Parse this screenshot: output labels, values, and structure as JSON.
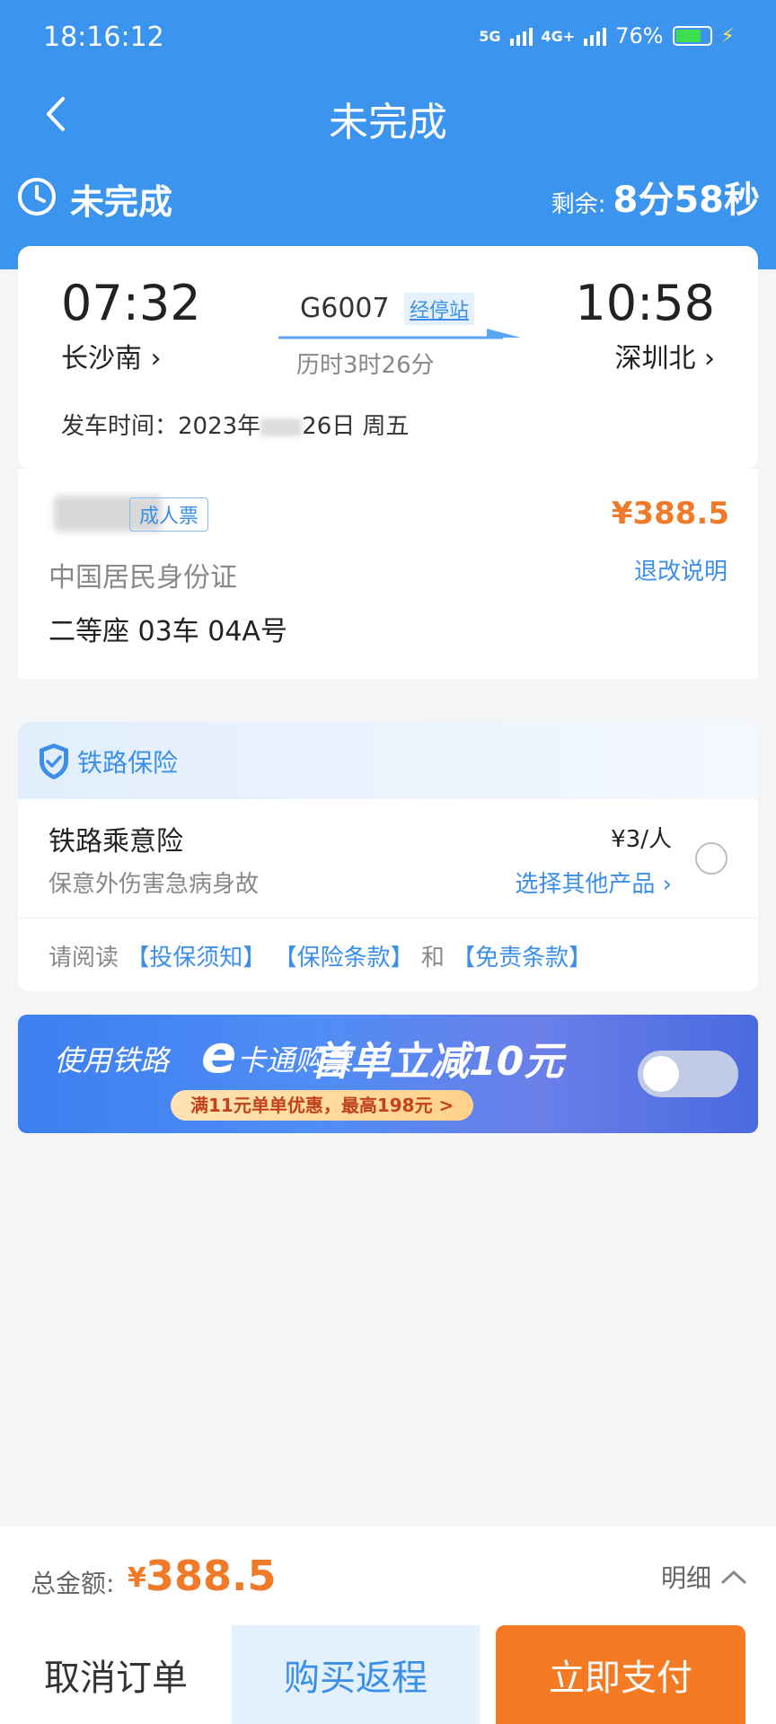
{
  "status_bar": {
    "time": "18:16:12",
    "net1": "5G",
    "net2": "4G+",
    "battery": "76%",
    "battery_level": 0.76
  },
  "nav": {
    "title": "未完成"
  },
  "order_status": {
    "label": "未完成",
    "remaining_label": "剩余:",
    "remaining_value": "8分58秒"
  },
  "trip": {
    "depart_time": "07:32",
    "depart_station": "长沙南 ›",
    "train_no": "G6007",
    "stops_link": "经停站",
    "duration": "历时3时26分",
    "arrive_time": "10:58",
    "arrive_station": "深圳北 ›",
    "depart_date": "发车时间：2023年",
    "depart_date_tail": "26日 周五"
  },
  "passenger": {
    "ticket_type": "成人票",
    "price": "¥388.5",
    "id_type": "中国居民身份证",
    "refund_link": "退改说明",
    "seat": "二等座 03车 04A号"
  },
  "insurance": {
    "section_title": "铁路保险",
    "name": "铁路乘意险",
    "desc": "保意外伤害急病身故",
    "price": "¥3/人",
    "other_link": "选择其他产品 ›",
    "read_prefix": "请阅读",
    "link1": "【投保须知】",
    "link2": "【保险条款】",
    "and": "和",
    "link3": "【免责条款】"
  },
  "banner": {
    "text1": "使用铁路",
    "ecard": "e",
    "text2": "卡通购票",
    "text3": "首单立减10元",
    "pill": "满11元单单优惠，最高198元 >"
  },
  "bottom": {
    "total_label": "总金额:",
    "currency": "¥",
    "total_value": "388.5",
    "detail": "明细",
    "cancel": "取消订单",
    "return": "购买返程",
    "pay": "立即支付"
  },
  "colors": {
    "primary": "#3b95ee",
    "accent": "#f07a28",
    "link": "#3b8fe8"
  }
}
